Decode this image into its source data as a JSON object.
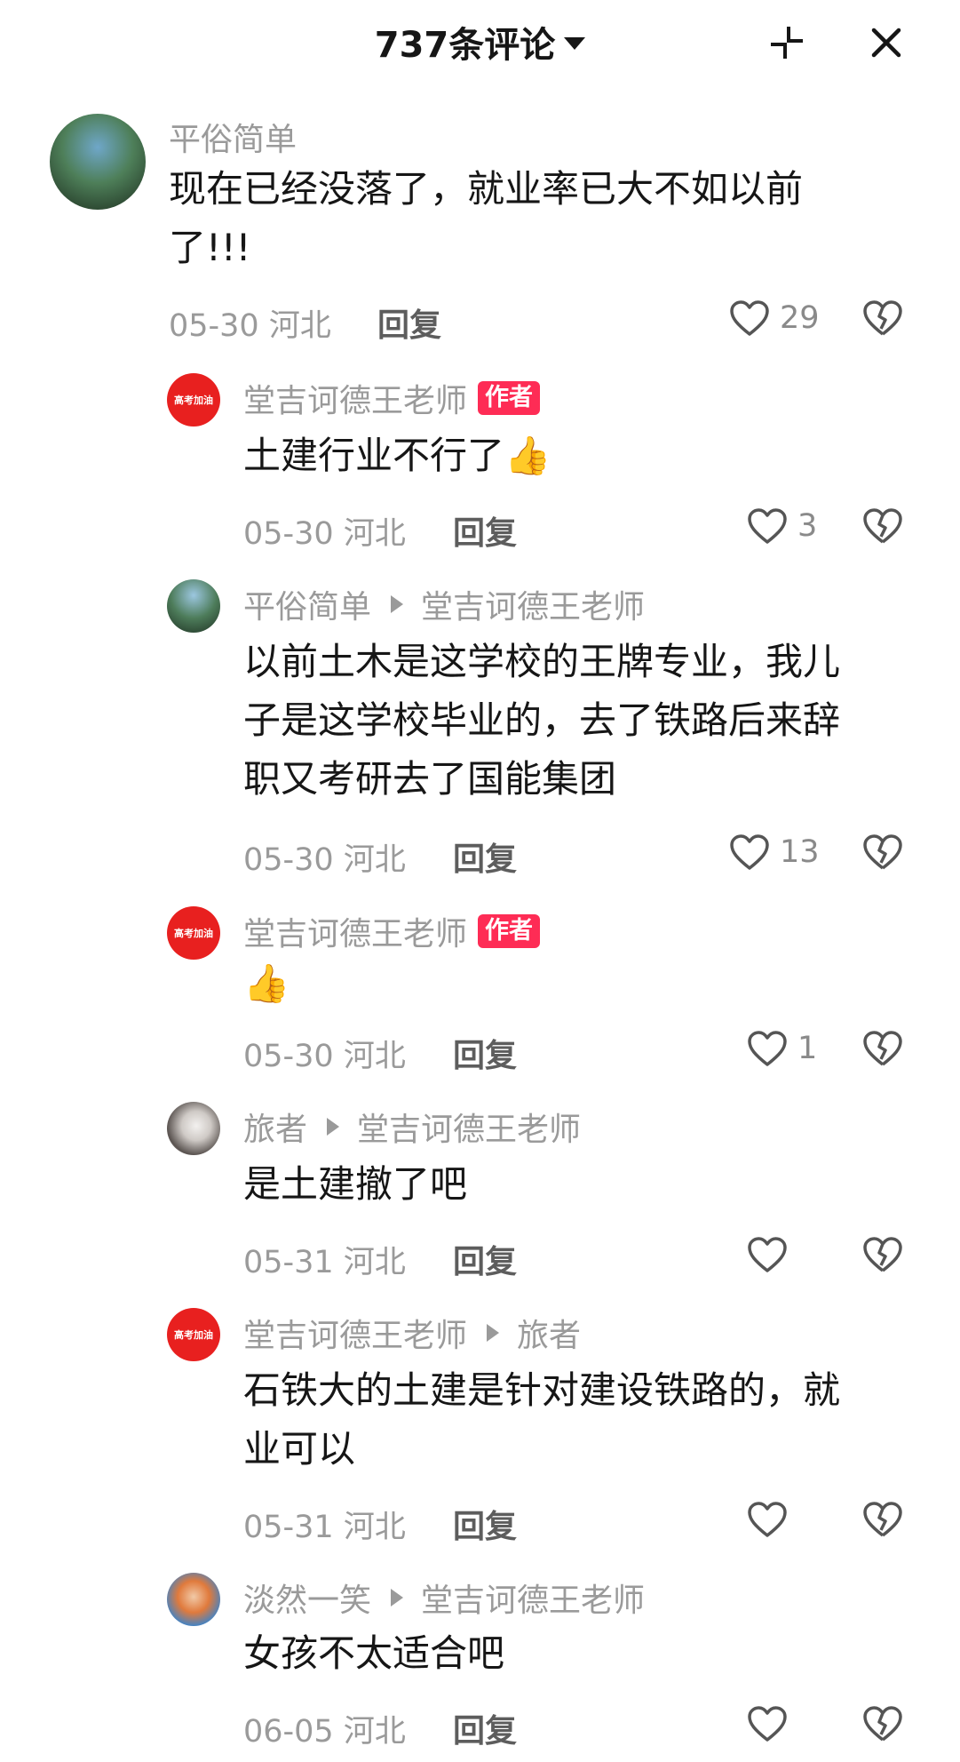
{
  "header": {
    "title": "737条评论"
  },
  "comments": [
    {
      "author": "平俗简单",
      "reply_to": "",
      "badge": "",
      "text_line1": "现在已经没落了，就业率已大不如以前",
      "text_line2": "了!!!",
      "date": "05-30 河北",
      "reply_label": "回复",
      "likes": "29",
      "avatar": "landscape-avatar"
    },
    {
      "author": "堂吉诃德王老师",
      "reply_to": "",
      "badge": "作者",
      "text": "土建行业不行了",
      "emoji": "👍",
      "date": "05-30 河北",
      "reply_label": "回复",
      "likes": "3",
      "avatar": "red-avatar",
      "avatar_text": "高考加油"
    },
    {
      "author": "平俗简单",
      "reply_to": "堂吉诃德王老师",
      "text_line1": "以前土木是这学校的王牌专业，我儿",
      "text_line2": "子是这学校毕业的，去了铁路后来辞",
      "text_line3": "职又考研去了国能集团",
      "date": "05-30 河北",
      "reply_label": "回复",
      "likes": "13",
      "avatar": "landscape-avatar"
    },
    {
      "author": "堂吉诃德王老师",
      "badge": "作者",
      "emoji": "👍",
      "date": "05-30 河北",
      "reply_label": "回复",
      "likes": "1",
      "avatar": "red-avatar",
      "avatar_text": "高考加油"
    },
    {
      "author": "旅者",
      "reply_to": "堂吉诃德王老师",
      "text": "是土建撤了吧",
      "date": "05-31 河北",
      "reply_label": "回复",
      "likes": "",
      "avatar": "traveler-avatar"
    },
    {
      "author": "堂吉诃德王老师",
      "reply_to": "旅者",
      "text_line1": "石铁大的土建是针对建设铁路的，就",
      "text_line2": "业可以",
      "date": "05-31 河北",
      "reply_label": "回复",
      "likes": "",
      "avatar": "red-avatar",
      "avatar_text": "高考加油"
    },
    {
      "author": "淡然一笑",
      "reply_to": "堂吉诃德王老师",
      "text": "女孩不太适合吧",
      "date": "06-05 河北",
      "reply_label": "回复",
      "likes": "",
      "avatar": "smile-avatar"
    }
  ],
  "icons": {
    "like": "heart-outline-icon",
    "dislike": "broken-heart-icon",
    "collapse": "collapse-icon",
    "close": "close-icon"
  },
  "colors": {
    "badge": "#fe2c55",
    "muted": "#9a9a9a",
    "text": "#161616",
    "avatar_red": "#e8201f"
  }
}
